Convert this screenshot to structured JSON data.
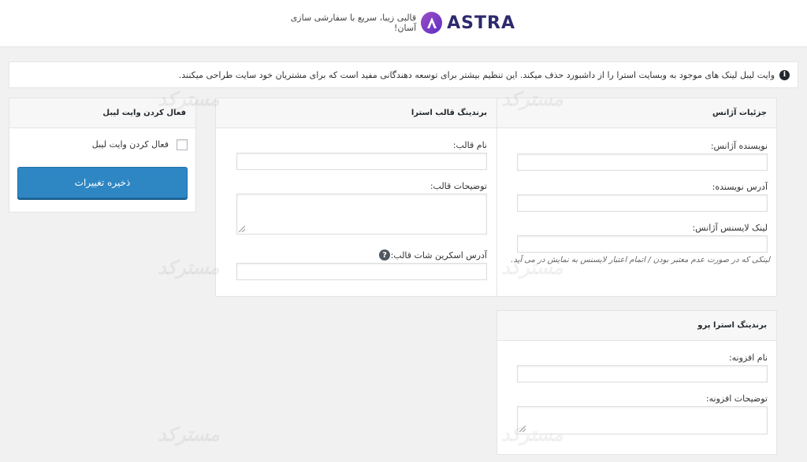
{
  "header": {
    "brand_name": "ASTRA",
    "tagline": "قالبی زیبا، سریع با سفارشی سازی آسان!"
  },
  "notice": {
    "text": "وایت لیبل لینک های موجود به وبسایت استرا را از داشبورد حذف میکند. این تنظیم بیشتر برای توسعه دهندگانی مفید است که برای مشتریان خود سایت طراحی میکنند."
  },
  "agency": {
    "title": "جزئیات آژانس",
    "author_label": "نویسنده آژانس:",
    "author_url_label": "آدرس نویسنده:",
    "license_label": "لینک لایسنس آژانس:",
    "license_help": "لینکی که در صورت عدم معتبر بودن / اتمام اعتبار لایسنس به نمایش در می آید."
  },
  "theme_branding": {
    "title": "برندینگ قالب استرا",
    "name_label": "نام قالب:",
    "description_label": "توضیحات قالب:",
    "screenshot_label": "آدرس اسکرین شات قالب:"
  },
  "enable": {
    "title": "فعال کردن وایت لیبل",
    "checkbox_label": "فعال کردن وایت لیبل",
    "save_label": "ذخیره تغییرات"
  },
  "pro_branding": {
    "title": "برندینگ استرا پرو",
    "plugin_name_label": "نام افزونه:",
    "plugin_description_label": "توضیحات افزونه:"
  },
  "watermark": "مسترکد",
  "colors": {
    "primary_button": "#2e87c3",
    "brand_purple": "#5b2ec9"
  }
}
